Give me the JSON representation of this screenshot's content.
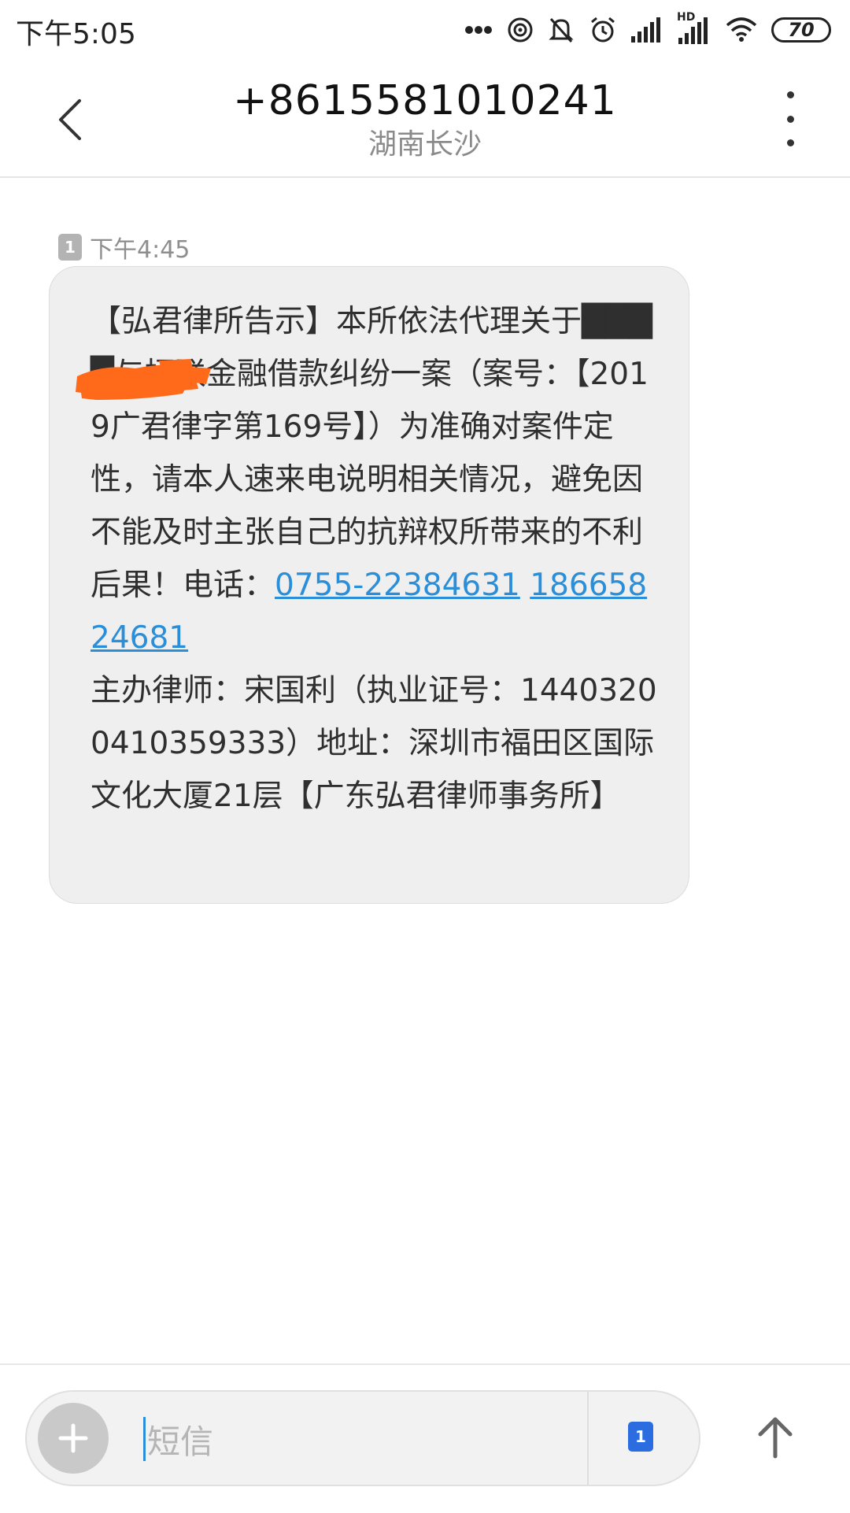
{
  "status_bar": {
    "time": "下午5:05",
    "battery": "70",
    "hd_label": "HD",
    "icons": [
      "more-dots-icon",
      "hotspot-icon",
      "mute-bell-icon",
      "alarm-icon",
      "signal-icon",
      "hd-signal-icon",
      "wifi-icon",
      "battery-icon"
    ]
  },
  "header": {
    "phone_number": "+8615581010241",
    "location": "湖南长沙"
  },
  "message": {
    "sim_slot": "1",
    "time": "下午4:45",
    "text_before_links": "【弘君律所告示】本所依法代理关于████与招联金融借款纠纷一案（案号：【2019广君律字第169号】）为准确对案件定性，请本人速来电说明相关情况，避免因不能及时主张自己的抗辩权所带来的不利后果！电话：",
    "link1": "0755-22384631",
    "link2": "18665824681",
    "text_after_links": "主办律师：宋国利（执业证号：14403200410359333）地址：深圳市福田区国际文化大厦21层【广东弘君律师事务所】"
  },
  "input_bar": {
    "placeholder": "短信",
    "sim_slot": "1"
  },
  "colors": {
    "link": "#2b8ed8",
    "bubble": "#efefef",
    "redaction": "#ff6a1a",
    "sim_select": "#2b6de0"
  }
}
